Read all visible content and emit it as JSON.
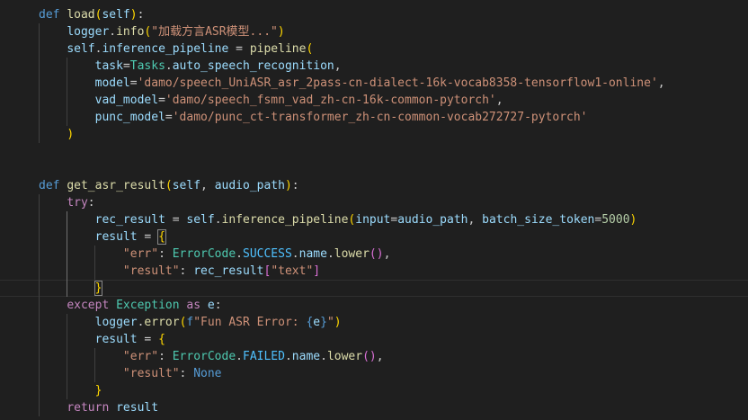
{
  "editor": {
    "lines": [
      {
        "tokens": [
          {
            "t": "def",
            "c": "k-def"
          },
          {
            "t": " "
          },
          {
            "t": "load",
            "c": "fn"
          },
          {
            "t": "(",
            "c": "b1"
          },
          {
            "t": "self",
            "c": "var"
          },
          {
            "t": ")",
            "c": "b1"
          },
          {
            "t": ":"
          }
        ]
      },
      {
        "tokens": [
          {
            "t": "    "
          },
          {
            "t": "logger",
            "c": "var"
          },
          {
            "t": "."
          },
          {
            "t": "info",
            "c": "fn"
          },
          {
            "t": "(",
            "c": "b1"
          },
          {
            "t": "\"加载方言ASR模型...\"",
            "c": "str"
          },
          {
            "t": ")",
            "c": "b1"
          }
        ]
      },
      {
        "tokens": [
          {
            "t": "    "
          },
          {
            "t": "self",
            "c": "var"
          },
          {
            "t": "."
          },
          {
            "t": "inference_pipeline",
            "c": "var"
          },
          {
            "t": " = "
          },
          {
            "t": "pipeline",
            "c": "fn"
          },
          {
            "t": "(",
            "c": "b1"
          }
        ]
      },
      {
        "tokens": [
          {
            "t": "        "
          },
          {
            "t": "task",
            "c": "var"
          },
          {
            "t": "="
          },
          {
            "t": "Tasks",
            "c": "cls"
          },
          {
            "t": "."
          },
          {
            "t": "auto_speech_recognition",
            "c": "var"
          },
          {
            "t": ","
          }
        ]
      },
      {
        "tokens": [
          {
            "t": "        "
          },
          {
            "t": "model",
            "c": "var"
          },
          {
            "t": "="
          },
          {
            "t": "'damo/speech_UniASR_asr_2pass-cn-dialect-16k-vocab8358-tensorflow1-online'",
            "c": "str"
          },
          {
            "t": ","
          }
        ]
      },
      {
        "tokens": [
          {
            "t": "        "
          },
          {
            "t": "vad_model",
            "c": "var"
          },
          {
            "t": "="
          },
          {
            "t": "'damo/speech_fsmn_vad_zh-cn-16k-common-pytorch'",
            "c": "str"
          },
          {
            "t": ","
          }
        ]
      },
      {
        "tokens": [
          {
            "t": "        "
          },
          {
            "t": "punc_model",
            "c": "var"
          },
          {
            "t": "="
          },
          {
            "t": "'damo/punc_ct-transformer_zh-cn-common-vocab272727-pytorch'",
            "c": "str"
          }
        ]
      },
      {
        "tokens": [
          {
            "t": "    "
          },
          {
            "t": ")",
            "c": "b1"
          }
        ]
      },
      {
        "tokens": []
      },
      {
        "tokens": []
      },
      {
        "tokens": [
          {
            "t": "def",
            "c": "k-def"
          },
          {
            "t": " "
          },
          {
            "t": "get_asr_result",
            "c": "fn"
          },
          {
            "t": "(",
            "c": "b1"
          },
          {
            "t": "self",
            "c": "var"
          },
          {
            "t": ", "
          },
          {
            "t": "audio_path",
            "c": "var"
          },
          {
            "t": ")",
            "c": "b1"
          },
          {
            "t": ":"
          }
        ]
      },
      {
        "tokens": [
          {
            "t": "    "
          },
          {
            "t": "try",
            "c": "k-ctl"
          },
          {
            "t": ":"
          }
        ]
      },
      {
        "tokens": [
          {
            "t": "        "
          },
          {
            "t": "rec_result",
            "c": "var"
          },
          {
            "t": " = "
          },
          {
            "t": "self",
            "c": "var"
          },
          {
            "t": "."
          },
          {
            "t": "inference_pipeline",
            "c": "fn"
          },
          {
            "t": "(",
            "c": "b1"
          },
          {
            "t": "input",
            "c": "var"
          },
          {
            "t": "="
          },
          {
            "t": "audio_path",
            "c": "var"
          },
          {
            "t": ", "
          },
          {
            "t": "batch_size_token",
            "c": "var"
          },
          {
            "t": "="
          },
          {
            "t": "5000",
            "c": "num"
          },
          {
            "t": ")",
            "c": "b1"
          }
        ]
      },
      {
        "tokens": [
          {
            "t": "        "
          },
          {
            "t": "result",
            "c": "var"
          },
          {
            "t": " = "
          },
          {
            "t": "{",
            "c": "b1 match"
          }
        ]
      },
      {
        "tokens": [
          {
            "t": "            "
          },
          {
            "t": "\"err\"",
            "c": "str"
          },
          {
            "t": ": "
          },
          {
            "t": "ErrorCode",
            "c": "cls"
          },
          {
            "t": "."
          },
          {
            "t": "SUCCESS",
            "c": "const"
          },
          {
            "t": "."
          },
          {
            "t": "name",
            "c": "var"
          },
          {
            "t": "."
          },
          {
            "t": "lower",
            "c": "fn"
          },
          {
            "t": "()",
            "c": "b2"
          },
          {
            "t": ","
          }
        ]
      },
      {
        "tokens": [
          {
            "t": "            "
          },
          {
            "t": "\"result\"",
            "c": "str"
          },
          {
            "t": ": "
          },
          {
            "t": "rec_result",
            "c": "var"
          },
          {
            "t": "[",
            "c": "b2"
          },
          {
            "t": "\"text\"",
            "c": "str"
          },
          {
            "t": "]",
            "c": "b2"
          }
        ]
      },
      {
        "tokens": [
          {
            "t": "        "
          },
          {
            "t": "}",
            "c": "b1 match"
          }
        ],
        "current": true
      },
      {
        "tokens": [
          {
            "t": "    "
          },
          {
            "t": "except",
            "c": "k-ctl"
          },
          {
            "t": " "
          },
          {
            "t": "Exception",
            "c": "cls"
          },
          {
            "t": " "
          },
          {
            "t": "as",
            "c": "k-ctl"
          },
          {
            "t": " "
          },
          {
            "t": "e",
            "c": "var"
          },
          {
            "t": ":"
          }
        ]
      },
      {
        "tokens": [
          {
            "t": "        "
          },
          {
            "t": "logger",
            "c": "var"
          },
          {
            "t": "."
          },
          {
            "t": "error",
            "c": "fn"
          },
          {
            "t": "(",
            "c": "b1"
          },
          {
            "t": "f",
            "c": "k-def"
          },
          {
            "t": "\"Fun ASR Error: ",
            "c": "str"
          },
          {
            "t": "{",
            "c": "k-def"
          },
          {
            "t": "e",
            "c": "var"
          },
          {
            "t": "}",
            "c": "k-def"
          },
          {
            "t": "\"",
            "c": "str"
          },
          {
            "t": ")",
            "c": "b1"
          }
        ]
      },
      {
        "tokens": [
          {
            "t": "        "
          },
          {
            "t": "result",
            "c": "var"
          },
          {
            "t": " = "
          },
          {
            "t": "{",
            "c": "b1"
          }
        ]
      },
      {
        "tokens": [
          {
            "t": "            "
          },
          {
            "t": "\"err\"",
            "c": "str"
          },
          {
            "t": ": "
          },
          {
            "t": "ErrorCode",
            "c": "cls"
          },
          {
            "t": "."
          },
          {
            "t": "FAILED",
            "c": "const"
          },
          {
            "t": "."
          },
          {
            "t": "name",
            "c": "var"
          },
          {
            "t": "."
          },
          {
            "t": "lower",
            "c": "fn"
          },
          {
            "t": "()",
            "c": "b2"
          },
          {
            "t": ","
          }
        ]
      },
      {
        "tokens": [
          {
            "t": "            "
          },
          {
            "t": "\"result\"",
            "c": "str"
          },
          {
            "t": ": "
          },
          {
            "t": "None",
            "c": "k-def"
          }
        ]
      },
      {
        "tokens": [
          {
            "t": "        "
          },
          {
            "t": "}",
            "c": "b1"
          }
        ]
      },
      {
        "tokens": [
          {
            "t": "    "
          },
          {
            "t": "return",
            "c": "k-ctl"
          },
          {
            "t": " "
          },
          {
            "t": "result",
            "c": "var"
          }
        ]
      }
    ]
  }
}
